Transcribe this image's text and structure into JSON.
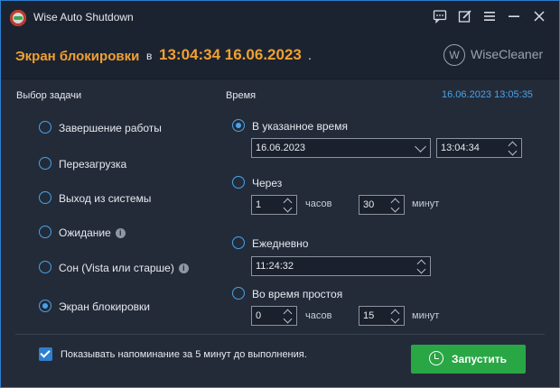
{
  "window": {
    "title": "Wise Auto Shutdown"
  },
  "header": {
    "task_name": "Экран блокировки",
    "in_word": "в",
    "scheduled_time": "13:04:34 16.06.2023",
    "trailing": ".",
    "brand_logo_letter": "W",
    "brand_name": "WiseCleaner"
  },
  "tasks": {
    "label": "Выбор задачи",
    "items": [
      {
        "label": "Завершение работы",
        "checked": false,
        "info": false
      },
      {
        "label": "Перезагрузка",
        "checked": false,
        "info": false
      },
      {
        "label": "Выход из системы",
        "checked": false,
        "info": false
      },
      {
        "label": "Ожидание",
        "checked": false,
        "info": true
      },
      {
        "label": "Сон (Vista или старше)",
        "checked": false,
        "info": true
      },
      {
        "label": "Экран блокировки",
        "checked": true,
        "info": false
      }
    ]
  },
  "time": {
    "label": "Время",
    "current": "16.06.2023 13:05:35",
    "specified": {
      "label": "В указанное время",
      "checked": true,
      "date": "16.06.2023",
      "time": "13:04:34"
    },
    "after": {
      "label": "Через",
      "checked": false,
      "hours_value": "1",
      "hours_unit": "часов",
      "minutes_value": "30",
      "minutes_unit": "минут"
    },
    "daily": {
      "label": "Ежедневно",
      "checked": false,
      "time": "11:24:32"
    },
    "idle": {
      "label": "Во время простоя",
      "checked": false,
      "hours_value": "0",
      "hours_unit": "часов",
      "minutes_value": "15",
      "minutes_unit": "минут"
    }
  },
  "footer": {
    "reminder_label": "Показывать напоминание за 5 минут до выполнения.",
    "reminder_checked": true,
    "start_label": "Запустить"
  },
  "colors": {
    "accent": "#f0a030",
    "blue": "#4aa3e8",
    "start_button": "#29a745",
    "background": "#232b39"
  }
}
